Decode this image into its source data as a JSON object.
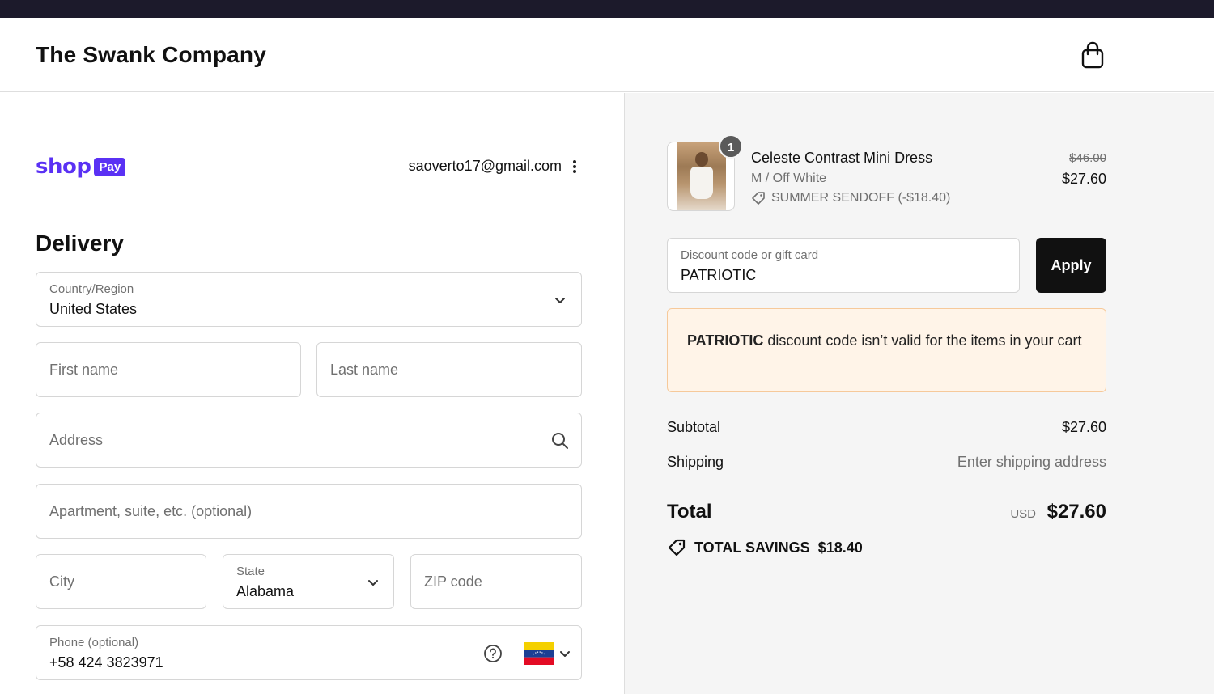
{
  "header": {
    "store_name": "The Swank Company",
    "cart_icon": "shopping-bag-icon"
  },
  "express": {
    "shop_word": "shop",
    "pay_word": "Pay",
    "account_email": "saoverto17@gmail.com",
    "brand_color": "#5a31f4"
  },
  "delivery": {
    "title": "Delivery",
    "country": {
      "label": "Country/Region",
      "value": "United States"
    },
    "first_name": {
      "placeholder": "First name"
    },
    "last_name": {
      "placeholder": "Last name"
    },
    "address": {
      "placeholder": "Address"
    },
    "apartment": {
      "placeholder": "Apartment, suite, etc. (optional)"
    },
    "city": {
      "placeholder": "City"
    },
    "state": {
      "label": "State",
      "value": "Alabama"
    },
    "zip": {
      "placeholder": "ZIP code"
    },
    "phone": {
      "label": "Phone (optional)",
      "value": "+58 424 3823971",
      "country_flag": "venezuela-flag-icon"
    }
  },
  "order": {
    "item": {
      "quantity": "1",
      "name": "Celeste Contrast Mini Dress",
      "variant": "M / Off White",
      "discount_label": "SUMMER SENDOFF (-$18.40)",
      "original_price": "$46.00",
      "price": "$27.60"
    },
    "discount": {
      "label": "Discount code or gift card",
      "value": "PATRIOTIC",
      "apply_label": "Apply"
    },
    "alert": {
      "code": "PATRIOTIC",
      "message": " discount code isn’t valid for the items in your cart"
    },
    "subtotal_label": "Subtotal",
    "subtotal_value": "$27.60",
    "shipping_label": "Shipping",
    "shipping_value": "Enter shipping address",
    "total_label": "Total",
    "total_currency": "USD",
    "total_value": "$27.60",
    "savings_label": "TOTAL SAVINGS",
    "savings_value": "$18.40"
  },
  "colors": {
    "alert_bg": "#fff4e8",
    "alert_border": "#f6c99a",
    "apply_bg": "#111111",
    "summary_bg": "#f5f5f5"
  }
}
